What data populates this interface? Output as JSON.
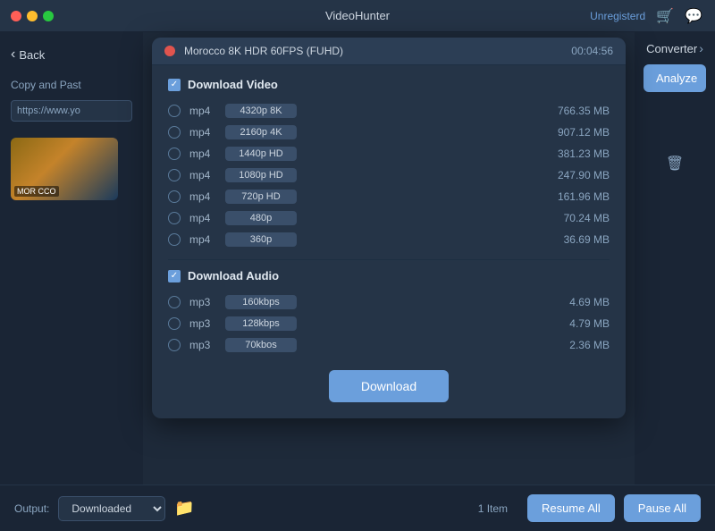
{
  "app": {
    "title": "VideoHunter",
    "unregistered": "Unregisterd"
  },
  "titlebar": {
    "traffic_lights": [
      "red",
      "yellow",
      "green"
    ]
  },
  "sidebar": {
    "back_label": "Back",
    "copy_paste_label": "Copy and Past",
    "url_value": "https://www.yo",
    "thumbnail_label": "MOR CCO"
  },
  "right_sidebar": {
    "converter_label": "Converter"
  },
  "analyze_button": "Analyze",
  "modal": {
    "title": "Morocco 8K HDR 60FPS (FUHD)",
    "duration": "00:04:56",
    "download_video_label": "Download Video",
    "download_audio_label": "Download Audio",
    "video_formats": [
      {
        "type": "mp4",
        "quality": "4320p 8K",
        "size": "766.35 MB",
        "selected": false
      },
      {
        "type": "mp4",
        "quality": "2160p 4K",
        "size": "907.12 MB",
        "selected": false
      },
      {
        "type": "mp4",
        "quality": "1440p HD",
        "size": "381.23 MB",
        "selected": false
      },
      {
        "type": "mp4",
        "quality": "1080p HD",
        "size": "247.90 MB",
        "selected": false
      },
      {
        "type": "mp4",
        "quality": "720p HD",
        "size": "161.96 MB",
        "selected": false
      },
      {
        "type": "mp4",
        "quality": "480p",
        "size": "70.24 MB",
        "selected": false
      },
      {
        "type": "mp4",
        "quality": "360p",
        "size": "36.69 MB",
        "selected": false
      }
    ],
    "audio_formats": [
      {
        "type": "mp3",
        "quality": "160kbps",
        "size": "4.69 MB",
        "selected": false
      },
      {
        "type": "mp3",
        "quality": "128kbps",
        "size": "4.79 MB",
        "selected": false
      },
      {
        "type": "mp3",
        "quality": "70kbos",
        "size": "2.36 MB",
        "selected": false
      }
    ],
    "download_button": "Download"
  },
  "bottom_bar": {
    "output_label": "Output:",
    "output_value": "Downloaded",
    "item_count": "1 Item",
    "resume_all": "Resume All",
    "pause_all": "Pause All"
  }
}
